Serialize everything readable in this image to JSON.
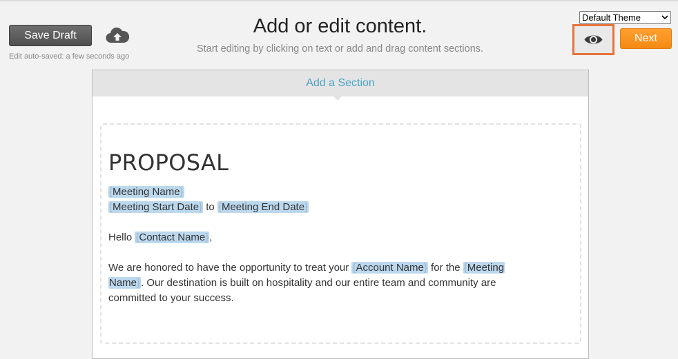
{
  "toolbar": {
    "save_label": "Save Draft",
    "autosave_text": "Edit auto-saved: a few seconds ago",
    "cloud_icon": "cloud-upload-icon"
  },
  "header": {
    "title": "Add or edit content.",
    "subtitle": "Start editing by clicking on text or add and drag content sections."
  },
  "theme": {
    "selected": "Default Theme"
  },
  "preview": {
    "icon": "eye-icon",
    "highlight_color": "#e6733c"
  },
  "next": {
    "label": "Next",
    "color": "#f7931e"
  },
  "editor": {
    "add_section_label": "Add a Section",
    "accent": "#4aa3c4",
    "title": "PROPOSAL",
    "tag_color": "#bcd8ee",
    "tags": {
      "meeting_name": "Meeting Name",
      "meeting_start_date": "Meeting Start Date",
      "meeting_end_date": "Meeting End Date",
      "contact_name": "Contact Name",
      "account_name": "Account Name",
      "meeting_name_part1": "Meeting",
      "meeting_name_part2": "Name"
    },
    "text": {
      "to": " to ",
      "hello": "Hello ",
      "comma": ",",
      "para_start": "We are honored to have the opportunity to treat your ",
      "for_the": " for the ",
      "para_end1": ". Our destination is built on hospitality and our entire team and community are",
      "para_end2": "committed to your success."
    }
  }
}
